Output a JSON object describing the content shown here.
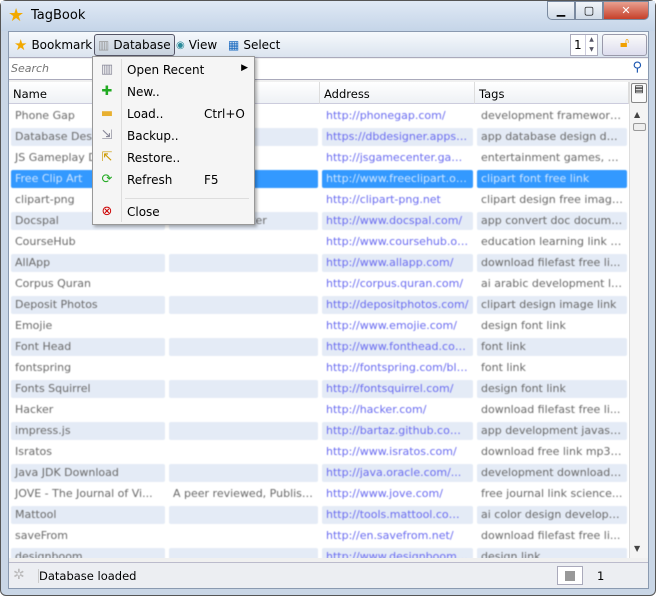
{
  "window": {
    "title": "TagBook",
    "icon": "star-icon"
  },
  "toolbar": {
    "bookmark": "Bookmark",
    "database": "Database",
    "view": "View",
    "select": "Select",
    "page": "1"
  },
  "search": {
    "placeholder": "Search"
  },
  "columns": [
    "Name",
    "",
    "Address",
    "Tags"
  ],
  "rows": [
    [
      "Phone Gap",
      "",
      "http://phonegap.com/",
      "development framework l..."
    ],
    [
      "Database Design",
      "",
      "https://dbdesigner.appspot.c...",
      "app database design dev..."
    ],
    [
      "JS Gameplay D...",
      "",
      "http://jsgamecenter.gamepa...",
      "entertainment games, M..."
    ],
    [
      "Free Clip Art",
      "",
      "http://www.freeclipart.org/",
      "clipart font free link"
    ],
    [
      "clipart-png",
      "",
      "http://clipart-png.net",
      "clipart design free image..."
    ],
    [
      "Docspal",
      "Online Converter",
      "http://www.docspal.com/",
      "app convert doc docume..."
    ],
    [
      "CourseHub",
      "",
      "http://www.coursehub.org/",
      "education learning link t..."
    ],
    [
      "AllApp",
      "",
      "http://www.allapp.com/",
      "download filefast free li..."
    ],
    [
      "Corpus Quran",
      "",
      "http://corpus.quran.com/",
      "ai arabic development li..."
    ],
    [
      "Deposit Photos",
      "",
      "http://depositphotos.com/",
      "clipart design image link"
    ],
    [
      "Emojie",
      "",
      "http://www.emojie.com/",
      "design font link"
    ],
    [
      "Font Head",
      "",
      "http://www.fonthead.com/",
      "font link"
    ],
    [
      "fontspring",
      "",
      "http://fontspring.com/blog...",
      "font link"
    ],
    [
      "Fonts Squirrel",
      "",
      "http://fontsquirrel.com/",
      "design font link"
    ],
    [
      "Hacker",
      "",
      "http://hacker.com/",
      "download filefast free li..."
    ],
    [
      "impress.js",
      "",
      "http://bartaz.github.com/...",
      "app development javascri..."
    ],
    [
      "Isratos",
      "",
      "http://www.isratos.com/",
      "download free link mp3 ..."
    ],
    [
      "Java JDK Download",
      "",
      "http://java.oracle.com/...",
      "development download j..."
    ],
    [
      "JOVE - The Journal of Vi...",
      "A peer reviewed, Publish...",
      "http://www.jove.com/",
      "free journal link science..."
    ],
    [
      "Mattool",
      "",
      "http://tools.mattool.com/s...",
      "ai color design developm..."
    ],
    [
      "saveFrom",
      "",
      "http://en.savefrom.net/",
      "download filefast free li..."
    ],
    [
      "designboom",
      "",
      "http://www.designboom.c...",
      "design link"
    ]
  ],
  "selected_row": 3,
  "menu": {
    "items": [
      {
        "label": "Open Recent",
        "shortcut": "",
        "submenu": true,
        "icon": "db-recent-icon"
      },
      {
        "label": "New..",
        "shortcut": "",
        "icon": "db-new-icon"
      },
      {
        "label": "Load..",
        "shortcut": "Ctrl+O",
        "icon": "folder-icon"
      },
      {
        "label": "Backup..",
        "shortcut": "",
        "icon": "backup-icon"
      },
      {
        "label": "Restore..",
        "shortcut": "",
        "icon": "restore-icon"
      },
      {
        "label": "Refresh",
        "shortcut": "F5",
        "icon": "refresh-icon"
      },
      {
        "label": "Close",
        "shortcut": "",
        "icon": "db-close-icon"
      }
    ]
  },
  "status": {
    "message": "Database loaded",
    "count": "1"
  }
}
